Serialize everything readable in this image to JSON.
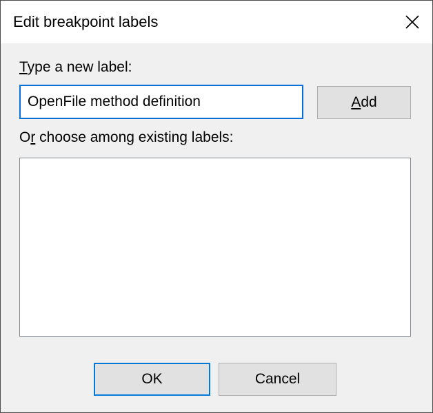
{
  "dialog": {
    "title": "Edit breakpoint labels"
  },
  "new_label": {
    "prompt_mnemonic": "T",
    "prompt_rest": "ype a new label:",
    "input_value": "OpenFile method definition"
  },
  "add_button": {
    "mnemonic": "A",
    "rest": "dd"
  },
  "existing_labels": {
    "prompt_first": "O",
    "prompt_mnemonic": "r",
    "prompt_rest": " choose among existing labels:",
    "items": []
  },
  "footer": {
    "ok_label": "OK",
    "cancel_label": "Cancel"
  },
  "icons": {
    "close": "close-icon"
  },
  "colors": {
    "focus_border": "#0078d7",
    "window_bg": "#f0f0f0",
    "button_bg": "#e1e1e1"
  }
}
